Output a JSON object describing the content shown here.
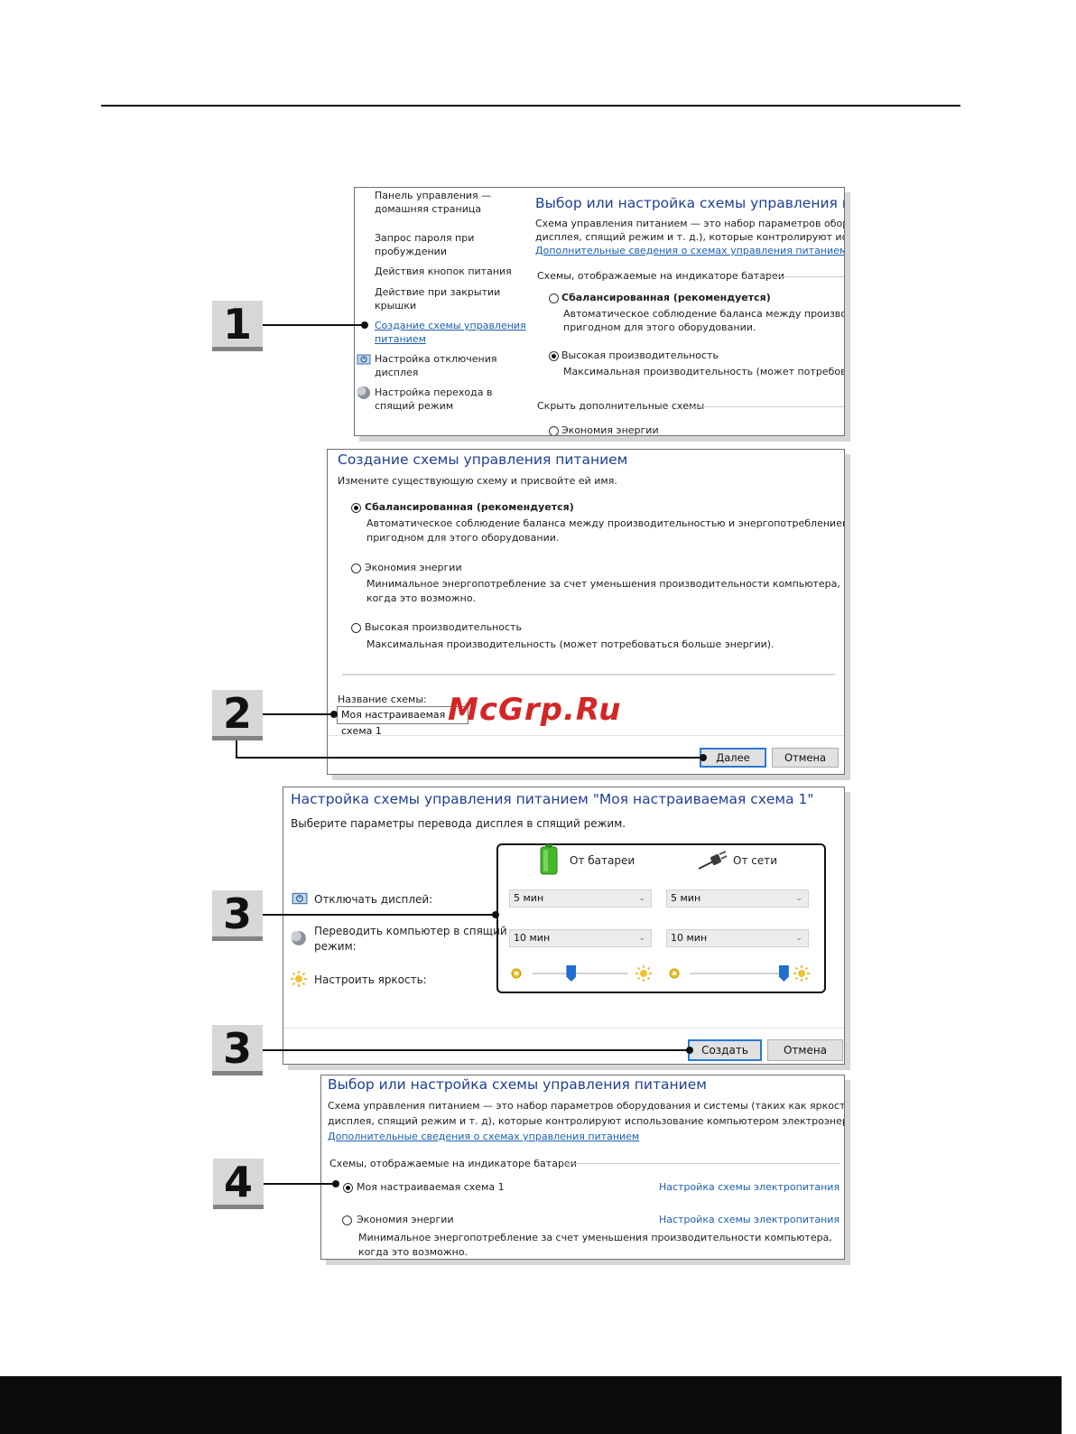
{
  "screen1": {
    "sidebar": [
      "Панель управления —",
      "домашняя страница",
      "Запрос пароля при",
      "пробуждении",
      "Действия кнопок питания",
      "Действие при закрытии",
      "крышки",
      "Создание схемы управления",
      "питанием",
      "Настройка отключения",
      "дисплея",
      "Настройка перехода в",
      "спящий режим"
    ],
    "title": "Выбор или настройка схемы управления питанием",
    "desc1": "Схема управления питанием — это набор параметров оборудован",
    "desc2": "дисплея, спящий режим и т. д.), которые контролируют использова",
    "link": "Дополнительные сведения о схемах управления питанием",
    "group_label": "Схемы, отображаемые на индикаторе батареи",
    "plan1_name": "Сбалансированная (рекомендуется)",
    "plan1_desc1": "Автоматическое соблюдение баланса между производителы",
    "plan1_desc2": "пригодном для этого оборудовании.",
    "plan2_name": "Высокая производительность",
    "plan2_desc": "Максимальная производительность (может потребоваться бо",
    "hidden_label": "Скрыть дополнительные схемы",
    "plan3_name": "Экономия энергии"
  },
  "screen2": {
    "title": "Создание схемы управления питанием",
    "subtitle": "Измените существующую схему и присвойте ей имя.",
    "opt1_name": "Сбалансированная (рекомендуется)",
    "opt1_desc1": "Автоматическое соблюдение баланса между производительностью и энергопотреблением на",
    "opt1_desc2": "пригодном для этого оборудовании.",
    "opt2_name": "Экономия энергии",
    "opt2_desc1": "Минимальное энергопотребление за счет уменьшения производительности компьютера,",
    "opt2_desc2": "когда это возможно.",
    "opt3_name": "Высокая производительность",
    "opt3_desc": "Максимальная производительность (может потребоваться больше энергии).",
    "name_label": "Название схемы:",
    "name_value": "Моя настраиваемая схема 1",
    "next": "Далее",
    "cancel": "Отмена"
  },
  "screen3": {
    "title": "Настройка схемы управления питанием \"Моя настраиваемая схема 1\"",
    "subtitle": "Выберите параметры перевода дисплея в спящий режим.",
    "on_battery": "От батареи",
    "plugged_in": "От сети",
    "turn_off_display": "Отключать дисплей:",
    "sleep_line1": "Переводить компьютер в спящий",
    "sleep_line2": "режим:",
    "brightness": "Настроить яркость:",
    "display_battery": "5 мин",
    "display_ac": "5 мин",
    "sleep_battery": "10 мин",
    "sleep_ac": "10 мин",
    "brightness_battery": 0.4,
    "brightness_ac": 0.98,
    "create": "Создать",
    "cancel": "Отмена"
  },
  "screen4": {
    "title": "Выбор или настройка схемы управления питанием",
    "desc1": "Схема управления питанием — это набор параметров оборудования и системы (таких как яркость",
    "desc2": "дисплея, спящий режим и т. д), которые контролируют использование компьютером электроэнергии.",
    "link": "Дополнительные сведения о схемах управления питанием",
    "group_label": "Схемы, отображаемые на индикаторе батареи",
    "plan1_name": "Моя настраиваемая схема 1",
    "plan1_link": "Настройка схемы электропитания",
    "plan2_name": "Экономия энергии",
    "plan2_link": "Настройка схемы электропитания",
    "plan2_desc1": "Минимальное энергопотребление за счет уменьшения производительности компьютера,",
    "plan2_desc2": "когда это возможно."
  },
  "steps": [
    "1",
    "2",
    "3",
    "3",
    "4"
  ],
  "watermark": "McGrp.Ru",
  "colors": {
    "heading": "#1f3f93",
    "link": "#1a5fb0",
    "accent": "#1f6fd1"
  }
}
